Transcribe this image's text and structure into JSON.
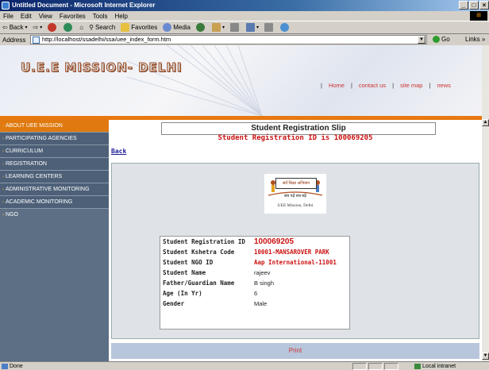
{
  "window": {
    "title": "Untitled Document - Microsoft Internet Explorer"
  },
  "menu": [
    "File",
    "Edit",
    "View",
    "Favorites",
    "Tools",
    "Help"
  ],
  "toolbar": {
    "back": "Back",
    "search": "Search",
    "favorites": "Favorites",
    "media": "Media"
  },
  "address": {
    "label": "Address",
    "url": "http://localhost/ssadelhi/ssa/uee_index_form.htm",
    "go": "Go",
    "links": "Links"
  },
  "site": {
    "logo": "U.E.E MISSION- DELHI",
    "nav": [
      "Home",
      "contact us",
      "site map",
      "news"
    ]
  },
  "sidebar": {
    "items": [
      "ABOUT UEE MISSION",
      "PARTICIPATING AGENCIES",
      "CURRICULUM",
      "REGISTRATION",
      "LEARNING CENTERS",
      "ADMINISTRATIVE MONITORING",
      "ACADEMIC MONITORING",
      "NGO"
    ]
  },
  "slip": {
    "title": "Student Registration Slip",
    "id_line": "Student Registration ID is 100069205",
    "back": "Back",
    "logo_banner": "सर्व शिक्षा अभियान",
    "logo_tagline": "सब पढ़ें सब बढ़ें",
    "logo_caption": "UEE Mission, Delhi",
    "rows": [
      {
        "label": "Student Registration ID",
        "value": "100069205"
      },
      {
        "label": "Student Kshetra Code",
        "value": "10001-MANSAROVER PARK"
      },
      {
        "label": "Student NGO ID",
        "value": "Aap International-11001"
      },
      {
        "label": "Student Name",
        "value": "rajeev"
      },
      {
        "label": "Father/Guardian Name",
        "value": "B singh"
      },
      {
        "label": "Age (In Yr)",
        "value": "6"
      },
      {
        "label": "Gender",
        "value": "Male"
      }
    ],
    "print": "Print"
  },
  "status": {
    "text": "Done",
    "zone": "Local intranet"
  }
}
